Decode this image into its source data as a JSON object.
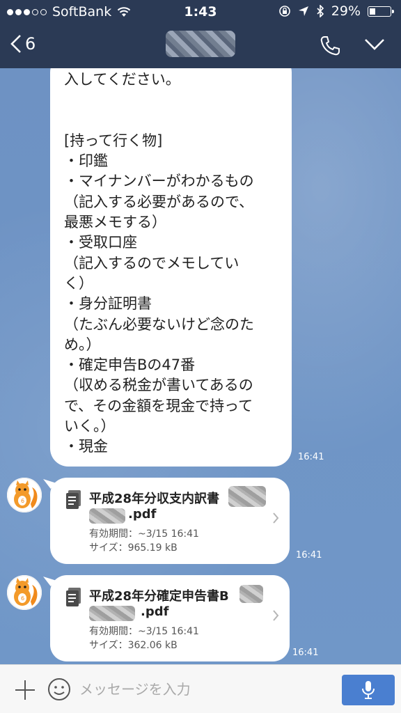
{
  "status_bar": {
    "carrier": "SoftBank",
    "time": "1:43",
    "battery": "29%",
    "signal_bars_filled": 3,
    "signal_bars_total": 5,
    "battery_level": 0.29
  },
  "nav": {
    "back_count": "6",
    "icons": [
      "chevron-left-icon",
      "phone-icon",
      "chevron-down-icon"
    ]
  },
  "messages": {
    "main": {
      "lines": [
        "入してください。",
        "",
        "",
        "[持って行く物]",
        "・印鑑",
        "・マイナンバーがわかるもの",
        "（記入する必要があるので、",
        "最悪メモする）",
        "・受取口座",
        "（記入するのでメモしてい",
        "く）",
        "・身分証明書",
        "（たぶん必要ないけど念のた",
        "め。）",
        "・確定申告Bの47番",
        "（収める税金が書いてあるの",
        "で、その金額を現金で持って",
        "いく。）",
        "・現金"
      ],
      "time": "16:41"
    },
    "files": [
      {
        "title": "平成28年分収支内訳書",
        "ext": ".pdf",
        "expiry": "有効期間：~3/15 16:41",
        "size": "サイズ：965.19 kB",
        "time": "16:41"
      },
      {
        "title": "平成28年分確定申告書B",
        "ext": ".pdf",
        "expiry": "有効期間：~3/15 16:41",
        "size": "サイズ：362.06 kB",
        "time": "16:41"
      }
    ]
  },
  "input_bar": {
    "placeholder": "メッセージを入力",
    "icons": [
      "plus-icon",
      "emoji-icon",
      "microphone-icon"
    ]
  },
  "colors": {
    "header": "#2b3a55",
    "chat_background": "#6f93c4",
    "mic_button": "#4a7fd0"
  }
}
